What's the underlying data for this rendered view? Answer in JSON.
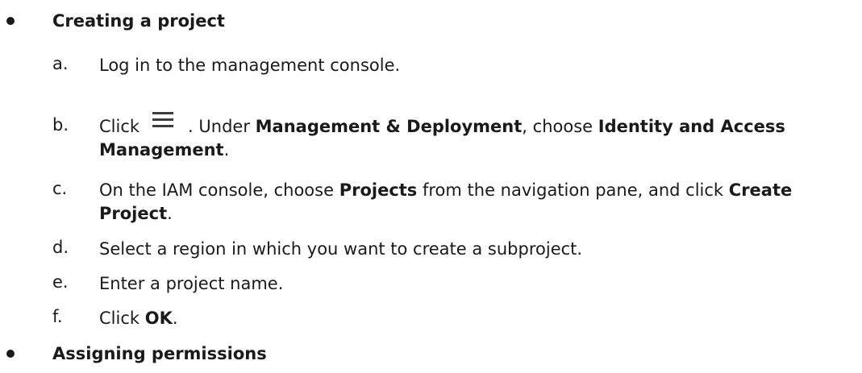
{
  "section1": {
    "title": "Creating a project",
    "steps": [
      {
        "marker": "a.",
        "text": "Log in to the management console."
      },
      {
        "marker": "b.",
        "pre": "Click",
        "icon": "menu-icon",
        "mid1": ". Under ",
        "bold1": "Management & Deployment",
        "mid2": ", choose ",
        "bold2": "Identity and Access Management",
        "post": "."
      },
      {
        "marker": "c.",
        "pre": "On the IAM console, choose ",
        "bold1": "Projects",
        "mid1": " from the navigation pane, and click ",
        "bold2": "Create Project",
        "post": "."
      },
      {
        "marker": "d.",
        "text": "Select a region in which you want to create a subproject."
      },
      {
        "marker": "e.",
        "text": "Enter a project name."
      },
      {
        "marker": "f.",
        "pre": "Click ",
        "bold1": "OK",
        "post": "."
      }
    ]
  },
  "section2": {
    "title": "Assigning permissions"
  }
}
